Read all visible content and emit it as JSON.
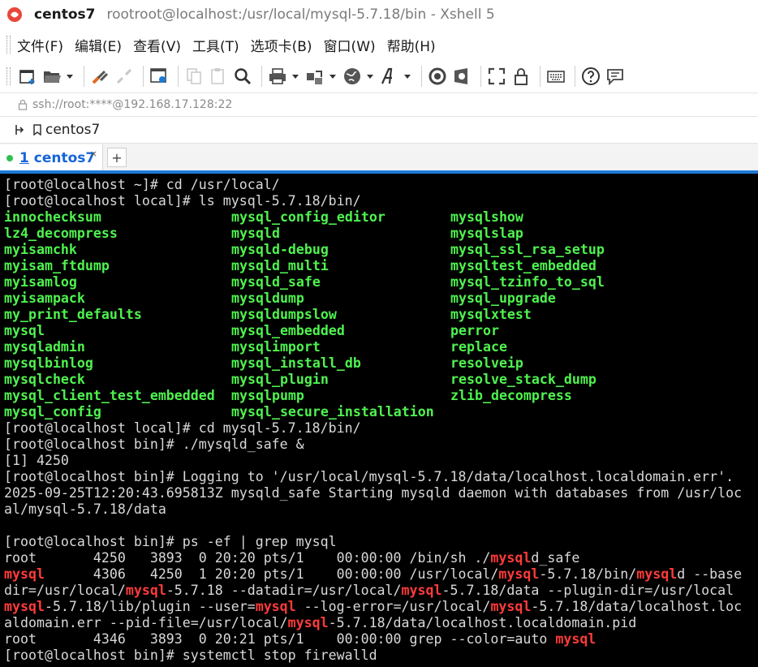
{
  "window": {
    "title_name": "centos7",
    "title_sub": "rootroot@localhost:/usr/local/mysql-5.7.18/bin - Xshell 5"
  },
  "menu": [
    "文件(F)",
    "编辑(E)",
    "查看(V)",
    "工具(T)",
    "选项卡(B)",
    "窗口(W)",
    "帮助(H)"
  ],
  "toolbar": {
    "icons": [
      "new-session-icon",
      "open-folder-icon",
      "dropdown-icon",
      "connect-icon",
      "disconnect-icon",
      "properties-icon",
      "copy-icon",
      "paste-icon",
      "find-icon",
      "print-icon",
      "transfer-icon",
      "globe-icon",
      "font-icon",
      "xftp-icon",
      "xmanager-icon",
      "fullscreen-icon",
      "lock-icon",
      "keyboard-icon",
      "help-icon",
      "chat-icon"
    ]
  },
  "address": "ssh://root:****@192.168.17.128:22",
  "session": "centos7",
  "tab": {
    "number": "1",
    "label": "centos7",
    "close": "×",
    "add": "+"
  },
  "terminal": {
    "l0": "[root@localhost ~]# cd /usr/local/",
    "l1": "[root@localhost local]# ls mysql-5.7.18/bin/",
    "ls_c1": [
      "innochecksum",
      "lz4_decompress",
      "myisamchk",
      "myisam_ftdump",
      "myisamlog",
      "myisampack",
      "my_print_defaults",
      "mysql",
      "mysqladmin",
      "mysqlbinlog",
      "mysqlcheck",
      "mysql_client_test_embedded",
      "mysql_config"
    ],
    "ls_c2": [
      "mysql_config_editor",
      "mysqld",
      "mysqld-debug",
      "mysqld_multi",
      "mysqld_safe",
      "mysqldump",
      "mysqldumpslow",
      "mysql_embedded",
      "mysqlimport",
      "mysql_install_db",
      "mysql_plugin",
      "mysqlpump",
      "mysql_secure_installation"
    ],
    "ls_c3": [
      "mysqlshow",
      "mysqlslap",
      "mysql_ssl_rsa_setup",
      "mysqltest_embedded",
      "mysql_tzinfo_to_sql",
      "mysql_upgrade",
      "mysqlxtest",
      "perror",
      "replace",
      "resolveip",
      "resolve_stack_dump",
      "zlib_decompress"
    ],
    "l15": "[root@localhost local]# cd mysql-5.7.18/bin/",
    "l16": "[root@localhost bin]# ./mysqld_safe &",
    "l17": "[1] 4250",
    "l18": "[root@localhost bin]# Logging to '/usr/local/mysql-5.7.18/data/localhost.localdomain.err'.",
    "l19": "2025-09-25T12:20:43.695813Z mysqld_safe Starting mysqld daemon with databases from /usr/loc",
    "l20": "al/mysql-5.7.18/data",
    "l22": "[root@localhost bin]# ps -ef | grep mysql",
    "p23": [
      "root       4250   3893  0 20:20 pts/1    00:00:00 /bin/sh ./",
      "mysql",
      "d_safe"
    ],
    "p24": [
      "mysql",
      "      4306   4250  1 20:20 pts/1    00:00:00 /usr/local/",
      "mysql",
      "-5.7.18/bin/",
      "mysql",
      "d --base"
    ],
    "p25": [
      "dir=/usr/local/",
      "mysql",
      "-5.7.18 --datadir=/usr/local/",
      "mysql",
      "-5.7.18/data --plugin-dir=/usr/local"
    ],
    "p26": [
      "mysql",
      "-5.7.18/lib/plugin --user=",
      "mysql",
      " --log-error=/usr/local/",
      "mysql",
      "-5.7.18/data/localhost.loc"
    ],
    "p27": [
      "aldomain.err --pid-file=/usr/local/",
      "mysql",
      "-5.7.18/data/localhost.localdomain.pid"
    ],
    "p28": [
      "root       4346   3893  0 20:21 pts/1    00:00:00 grep --color=auto ",
      "mysql"
    ],
    "l29": "[root@localhost bin]# systemctl stop firewalld"
  }
}
